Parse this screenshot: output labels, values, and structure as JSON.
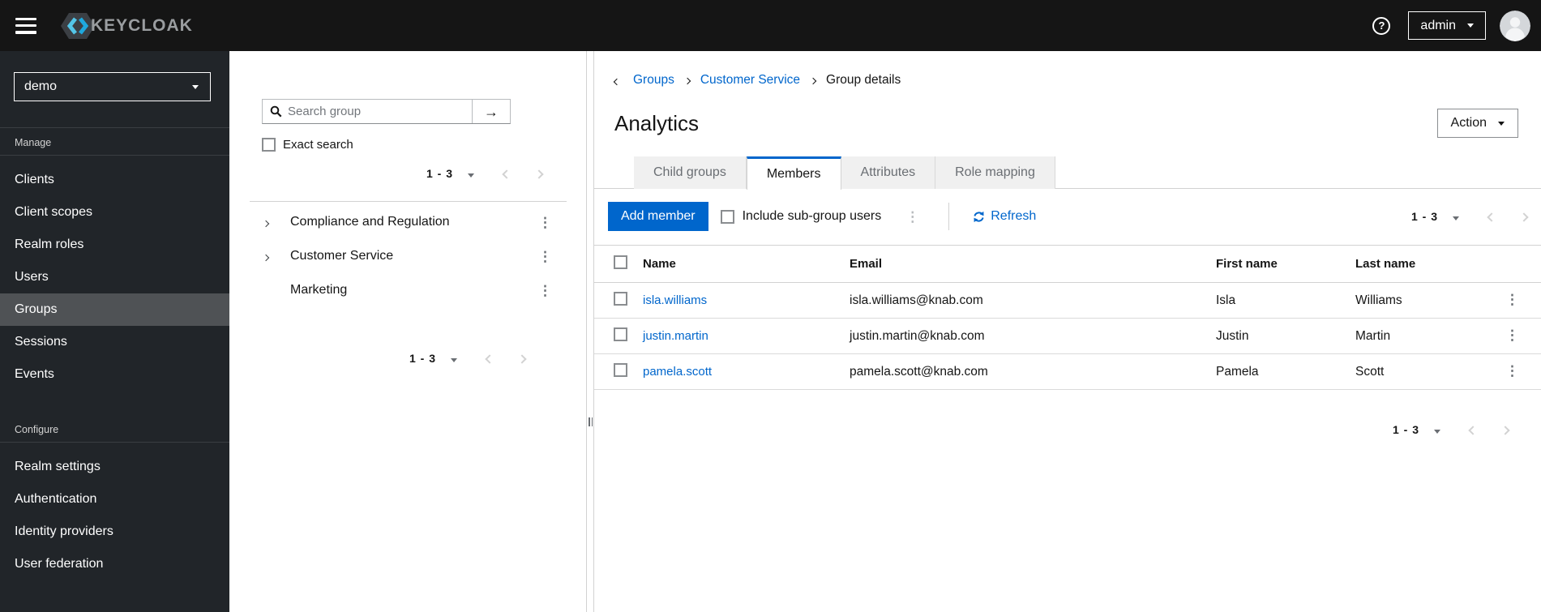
{
  "colors": {
    "accent": "#0066cc",
    "masthead_bg": "#151515",
    "sidebar_bg": "#212529",
    "sidebar_selected_bg": "#4f5255",
    "tab_inactive_bg": "#f0f0f0",
    "muted_text": "#6a6e73",
    "border": "#d2d2d2",
    "logo_cyan": "#54c6e8",
    "logo_blue": "#1fa8dd"
  },
  "masthead": {
    "brand": "KEYCLOAK",
    "username": "admin"
  },
  "sidebar": {
    "realm_selector": {
      "value": "demo"
    },
    "sections": [
      {
        "label": "Manage",
        "items": [
          {
            "label": "Clients"
          },
          {
            "label": "Client scopes"
          },
          {
            "label": "Realm roles"
          },
          {
            "label": "Users"
          },
          {
            "label": "Groups"
          },
          {
            "label": "Sessions"
          },
          {
            "label": "Events"
          }
        ]
      },
      {
        "label": "Configure",
        "items": [
          {
            "label": "Realm settings"
          },
          {
            "label": "Authentication"
          },
          {
            "label": "Identity providers"
          },
          {
            "label": "User federation"
          }
        ]
      }
    ]
  },
  "group_panel": {
    "search": {
      "placeholder": "Search group"
    },
    "exact_search_label": "Exact search",
    "pagination_top": {
      "range": "1 - 3"
    },
    "tree": [
      {
        "name": "Compliance and Regulation"
      },
      {
        "name": "Customer Service"
      },
      {
        "name": "Marketing"
      }
    ],
    "pagination_bottom": {
      "range": "1 - 3"
    }
  },
  "main": {
    "breadcrumb": {
      "items": [
        "Groups",
        "Customer Service",
        "Group details"
      ]
    },
    "title": "Analytics",
    "action_button": "Action",
    "tabs": [
      {
        "label": "Child groups"
      },
      {
        "label": "Members"
      },
      {
        "label": "Attributes"
      },
      {
        "label": "Role mapping"
      }
    ],
    "toolbar": {
      "add_member": "Add member",
      "include_subgroups": "Include sub-group users",
      "refresh": "Refresh",
      "pagination": {
        "range": "1 - 3"
      }
    },
    "table": {
      "headers": [
        "Name",
        "Email",
        "First name",
        "Last name"
      ],
      "rows": [
        {
          "name": "isla.williams",
          "email": "isla.williams@knab.com",
          "first_name": "Isla",
          "last_name": "Williams"
        },
        {
          "name": "justin.martin",
          "email": "justin.martin@knab.com",
          "first_name": "Justin",
          "last_name": "Martin"
        },
        {
          "name": "pamela.scott",
          "email": "pamela.scott@knab.com",
          "first_name": "Pamela",
          "last_name": "Scott"
        }
      ]
    },
    "pagination_bottom": {
      "range": "1 - 3"
    }
  }
}
